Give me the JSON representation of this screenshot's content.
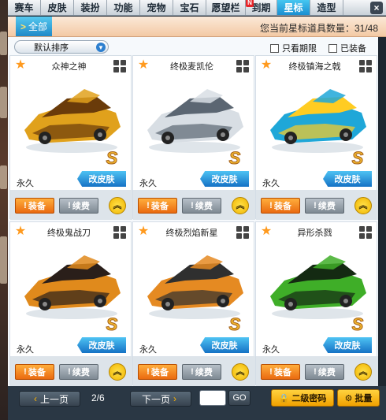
{
  "tabs": [
    {
      "label": "赛车",
      "active": false
    },
    {
      "label": "皮肤",
      "active": false
    },
    {
      "label": "装扮",
      "active": false
    },
    {
      "label": "功能",
      "active": false
    },
    {
      "label": "宠物",
      "active": false
    },
    {
      "label": "宝石",
      "active": false
    },
    {
      "label": "愿望栏",
      "active": false
    },
    {
      "label": "到期",
      "active": false,
      "badge": "N"
    },
    {
      "label": "星标",
      "active": true
    },
    {
      "label": "造型",
      "active": false
    }
  ],
  "close_label": "×",
  "filter": {
    "label": "全部",
    "chevron": ">"
  },
  "count_text": "您当前星标道具数量：31/48",
  "sort": {
    "selected": "默认排序"
  },
  "checkboxes": {
    "expiring_label": "只看期限",
    "equipped_label": "已装备"
  },
  "items": [
    {
      "name": "众神之神",
      "duration": "永久",
      "tag": "改皮肤",
      "grade": "S",
      "car_color": "#e0a11c",
      "car_accent": "#6a3b0a"
    },
    {
      "name": "终极麦凯伦",
      "duration": "永久",
      "tag": "改皮肤",
      "grade": "S",
      "car_color": "#d8dee4",
      "car_accent": "#5b6672"
    },
    {
      "name": "终极镇海之戟",
      "duration": "永久",
      "tag": "改皮肤",
      "grade": "S",
      "car_color": "#1fa7d8",
      "car_accent": "#ffcc22"
    },
    {
      "name": "终极鬼战刀",
      "duration": "永久",
      "tag": "改皮肤",
      "grade": "S",
      "car_color": "#e08a1c",
      "car_accent": "#2a1f1a"
    },
    {
      "name": "终极烈焰新星",
      "duration": "永久",
      "tag": "改皮肤",
      "grade": "S",
      "car_color": "#e58a22",
      "car_accent": "#2f2f2f"
    },
    {
      "name": "异形杀戮",
      "duration": "永久",
      "tag": "改皮肤",
      "grade": "S",
      "car_color": "#3fae28",
      "car_accent": "#142a12"
    }
  ],
  "buttons": {
    "equip": "装备",
    "renew": "续费",
    "upgrade": "︽"
  },
  "pagination": {
    "prev": "上一页",
    "next": "下一页",
    "page": "2/6",
    "go": "GO",
    "input_value": ""
  },
  "bottom_actions": {
    "password": "二级密码",
    "batch": "批量"
  }
}
